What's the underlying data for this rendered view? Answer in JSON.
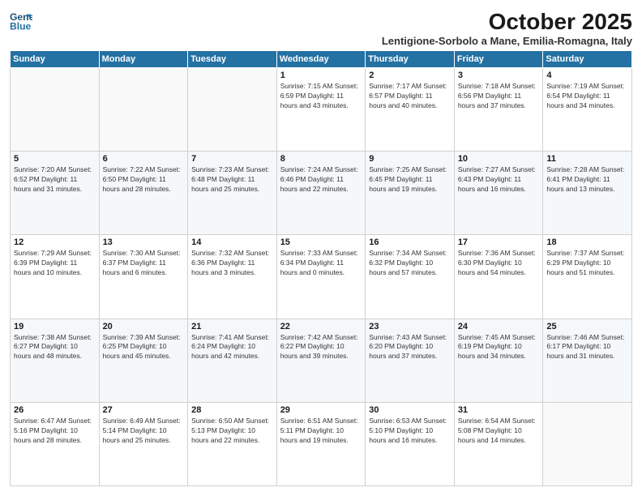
{
  "logo": {
    "line1": "General",
    "line2": "Blue"
  },
  "title": "October 2025",
  "subtitle": "Lentigione-Sorbolo a Mane, Emilia-Romagna, Italy",
  "days_of_week": [
    "Sunday",
    "Monday",
    "Tuesday",
    "Wednesday",
    "Thursday",
    "Friday",
    "Saturday"
  ],
  "weeks": [
    [
      {
        "day": "",
        "info": ""
      },
      {
        "day": "",
        "info": ""
      },
      {
        "day": "",
        "info": ""
      },
      {
        "day": "1",
        "info": "Sunrise: 7:15 AM\nSunset: 6:59 PM\nDaylight: 11 hours\nand 43 minutes."
      },
      {
        "day": "2",
        "info": "Sunrise: 7:17 AM\nSunset: 6:57 PM\nDaylight: 11 hours\nand 40 minutes."
      },
      {
        "day": "3",
        "info": "Sunrise: 7:18 AM\nSunset: 6:56 PM\nDaylight: 11 hours\nand 37 minutes."
      },
      {
        "day": "4",
        "info": "Sunrise: 7:19 AM\nSunset: 6:54 PM\nDaylight: 11 hours\nand 34 minutes."
      }
    ],
    [
      {
        "day": "5",
        "info": "Sunrise: 7:20 AM\nSunset: 6:52 PM\nDaylight: 11 hours\nand 31 minutes."
      },
      {
        "day": "6",
        "info": "Sunrise: 7:22 AM\nSunset: 6:50 PM\nDaylight: 11 hours\nand 28 minutes."
      },
      {
        "day": "7",
        "info": "Sunrise: 7:23 AM\nSunset: 6:48 PM\nDaylight: 11 hours\nand 25 minutes."
      },
      {
        "day": "8",
        "info": "Sunrise: 7:24 AM\nSunset: 6:46 PM\nDaylight: 11 hours\nand 22 minutes."
      },
      {
        "day": "9",
        "info": "Sunrise: 7:25 AM\nSunset: 6:45 PM\nDaylight: 11 hours\nand 19 minutes."
      },
      {
        "day": "10",
        "info": "Sunrise: 7:27 AM\nSunset: 6:43 PM\nDaylight: 11 hours\nand 16 minutes."
      },
      {
        "day": "11",
        "info": "Sunrise: 7:28 AM\nSunset: 6:41 PM\nDaylight: 11 hours\nand 13 minutes."
      }
    ],
    [
      {
        "day": "12",
        "info": "Sunrise: 7:29 AM\nSunset: 6:39 PM\nDaylight: 11 hours\nand 10 minutes."
      },
      {
        "day": "13",
        "info": "Sunrise: 7:30 AM\nSunset: 6:37 PM\nDaylight: 11 hours\nand 6 minutes."
      },
      {
        "day": "14",
        "info": "Sunrise: 7:32 AM\nSunset: 6:36 PM\nDaylight: 11 hours\nand 3 minutes."
      },
      {
        "day": "15",
        "info": "Sunrise: 7:33 AM\nSunset: 6:34 PM\nDaylight: 11 hours\nand 0 minutes."
      },
      {
        "day": "16",
        "info": "Sunrise: 7:34 AM\nSunset: 6:32 PM\nDaylight: 10 hours\nand 57 minutes."
      },
      {
        "day": "17",
        "info": "Sunrise: 7:36 AM\nSunset: 6:30 PM\nDaylight: 10 hours\nand 54 minutes."
      },
      {
        "day": "18",
        "info": "Sunrise: 7:37 AM\nSunset: 6:29 PM\nDaylight: 10 hours\nand 51 minutes."
      }
    ],
    [
      {
        "day": "19",
        "info": "Sunrise: 7:38 AM\nSunset: 6:27 PM\nDaylight: 10 hours\nand 48 minutes."
      },
      {
        "day": "20",
        "info": "Sunrise: 7:39 AM\nSunset: 6:25 PM\nDaylight: 10 hours\nand 45 minutes."
      },
      {
        "day": "21",
        "info": "Sunrise: 7:41 AM\nSunset: 6:24 PM\nDaylight: 10 hours\nand 42 minutes."
      },
      {
        "day": "22",
        "info": "Sunrise: 7:42 AM\nSunset: 6:22 PM\nDaylight: 10 hours\nand 39 minutes."
      },
      {
        "day": "23",
        "info": "Sunrise: 7:43 AM\nSunset: 6:20 PM\nDaylight: 10 hours\nand 37 minutes."
      },
      {
        "day": "24",
        "info": "Sunrise: 7:45 AM\nSunset: 6:19 PM\nDaylight: 10 hours\nand 34 minutes."
      },
      {
        "day": "25",
        "info": "Sunrise: 7:46 AM\nSunset: 6:17 PM\nDaylight: 10 hours\nand 31 minutes."
      }
    ],
    [
      {
        "day": "26",
        "info": "Sunrise: 6:47 AM\nSunset: 5:16 PM\nDaylight: 10 hours\nand 28 minutes."
      },
      {
        "day": "27",
        "info": "Sunrise: 6:49 AM\nSunset: 5:14 PM\nDaylight: 10 hours\nand 25 minutes."
      },
      {
        "day": "28",
        "info": "Sunrise: 6:50 AM\nSunset: 5:13 PM\nDaylight: 10 hours\nand 22 minutes."
      },
      {
        "day": "29",
        "info": "Sunrise: 6:51 AM\nSunset: 5:11 PM\nDaylight: 10 hours\nand 19 minutes."
      },
      {
        "day": "30",
        "info": "Sunrise: 6:53 AM\nSunset: 5:10 PM\nDaylight: 10 hours\nand 16 minutes."
      },
      {
        "day": "31",
        "info": "Sunrise: 6:54 AM\nSunset: 5:08 PM\nDaylight: 10 hours\nand 14 minutes."
      },
      {
        "day": "",
        "info": ""
      }
    ]
  ]
}
